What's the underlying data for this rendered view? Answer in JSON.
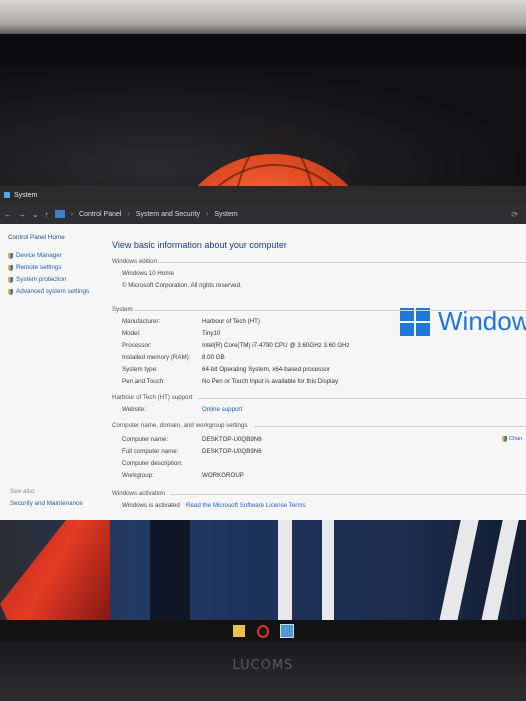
{
  "window": {
    "title": "System"
  },
  "address_bar": {
    "crumbs": [
      "Control Panel",
      "System and Security",
      "System"
    ]
  },
  "left_nav": {
    "home": "Control Panel Home",
    "items": [
      "Device Manager",
      "Remote settings",
      "System protection",
      "Advanced system settings"
    ],
    "see_also_label": "See also",
    "see_also_items": [
      "Security and Maintenance"
    ]
  },
  "main": {
    "heading": "View basic information about your computer",
    "edition": {
      "section": "Windows edition",
      "name": "Windows 10 Home",
      "copyright": "© Microsoft Corporation. All rights reserved.",
      "logo_text": "Window"
    },
    "system": {
      "section": "System",
      "rows": [
        {
          "label": "Manufacturer:",
          "value": "Harbour of Tech (HT)"
        },
        {
          "label": "Model:",
          "value": "Tiny10"
        },
        {
          "label": "Processor:",
          "value": "Intel(R) Core(TM) i7-4790 CPU @ 3.60GHz   3.60 GHz"
        },
        {
          "label": "Installed memory (RAM):",
          "value": "8.00 GB"
        },
        {
          "label": "System type:",
          "value": "64-bit Operating System, x64-based processor"
        },
        {
          "label": "Pen and Touch:",
          "value": "No Pen or Touch Input is available for this Display"
        }
      ]
    },
    "support": {
      "section": "Harbour of Tech (HT) support",
      "website_label": "Website:",
      "website_link": "Online support"
    },
    "computer_name": {
      "section": "Computer name, domain, and workgroup settings",
      "rows": [
        {
          "label": "Computer name:",
          "value": "DESKTOP-U0QB9N6"
        },
        {
          "label": "Full computer name:",
          "value": "DESKTOP-U0QB9N6"
        },
        {
          "label": "Computer description:",
          "value": ""
        },
        {
          "label": "Workgroup:",
          "value": "WORKGROUP"
        }
      ],
      "change_link": "Chan"
    },
    "activation": {
      "section": "Windows activation",
      "status": "Windows is activated",
      "license_link": "Read the Microsoft Software License Terms"
    }
  },
  "monitor": {
    "brand": "LUCOMS"
  },
  "colors": {
    "accent": "#1e78d7",
    "link": "#1a62c6"
  }
}
